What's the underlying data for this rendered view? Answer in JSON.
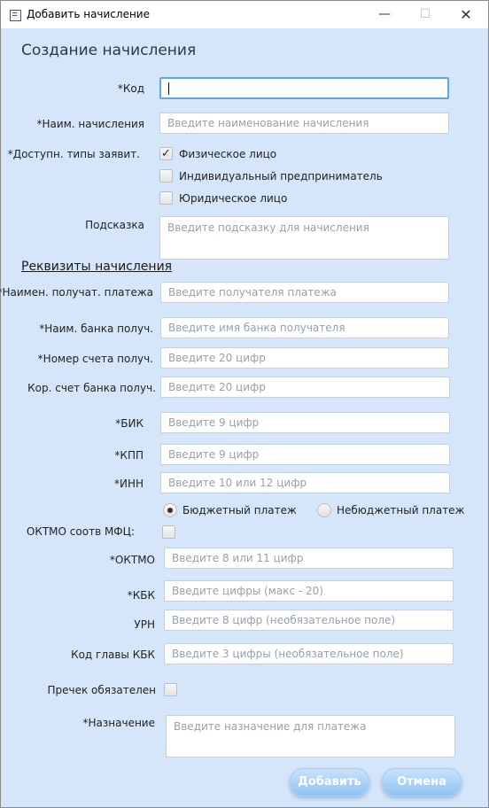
{
  "window": {
    "title": "Добавить начисление",
    "minimize_glyph": "—",
    "maximize_glyph": "☐",
    "close_glyph": "✕"
  },
  "form": {
    "heading": "Создание начисления",
    "code_label": "*Код",
    "code_value": "",
    "name_label": "*Наим. начисления",
    "name_placeholder": "Введите наименование начисления",
    "applicant_types_label": "*Доступн. типы заявит.",
    "applicant_types": [
      {
        "label": "Физическое лицо",
        "checked": true,
        "mark": "✓"
      },
      {
        "label": "Индивидуальный предприниматель",
        "checked": false,
        "mark": ""
      },
      {
        "label": "Юридическое лицо",
        "checked": false,
        "mark": ""
      }
    ],
    "hint_label": "Подсказка",
    "hint_placeholder": "Введите подсказку для начисления"
  },
  "requisites": {
    "section_title": "Реквизиты начисления",
    "recipient_label": "*Наимен. получат. платежа",
    "recipient_placeholder": "Введите получателя платежа",
    "bank_name_label": "*Наим. банка получ.",
    "bank_name_placeholder": "Введите имя банка получателя",
    "account_label": "*Номер счета получ.",
    "account_placeholder": "Введите 20 цифр",
    "corr_account_label": "Кор. счет банка получ.",
    "corr_account_placeholder": "Введите 20 цифр",
    "bik_label": "*БИК",
    "bik_placeholder": "Введите 9 цифр",
    "kpp_label": "*КПП",
    "kpp_placeholder": "Введите 9 цифр",
    "inn_label": "*ИНН",
    "inn_placeholder": "Введите 10 или 12 цифр",
    "payment_types": [
      {
        "label": "Бюджетный платеж",
        "checked": true
      },
      {
        "label": "Небюджетный платеж",
        "checked": false
      }
    ],
    "oktmo_mfc_label": "ОКТМО соотв МФЦ:",
    "oktmo_mfc_checked": false,
    "oktmo_label": "*ОКТМО",
    "oktmo_placeholder": "Введите 8 или 11 цифр",
    "kbk_label": "*КБК",
    "kbk_placeholder": "Введите цифры (макс - 20)",
    "urn_label": "УРН",
    "urn_placeholder": "Введите 8 цифр (необязательное поле)",
    "kbk_head_label": "Код главы КБК",
    "kbk_head_placeholder": "Введите 3 цифры (необязательное поле)",
    "precheck_label": "Пречек обязателен",
    "precheck_checked": false,
    "purpose_label": "*Назначение",
    "purpose_placeholder": "Введите назначение для платежа"
  },
  "actions": {
    "add_label": "Добавить",
    "cancel_label": "Отмена"
  },
  "colors": {
    "background": "#d6e6fa",
    "button_gradient_top": "#c9e2fb",
    "button_gradient_bottom": "#8ec2f2",
    "focus_border": "#5ea6e8"
  }
}
